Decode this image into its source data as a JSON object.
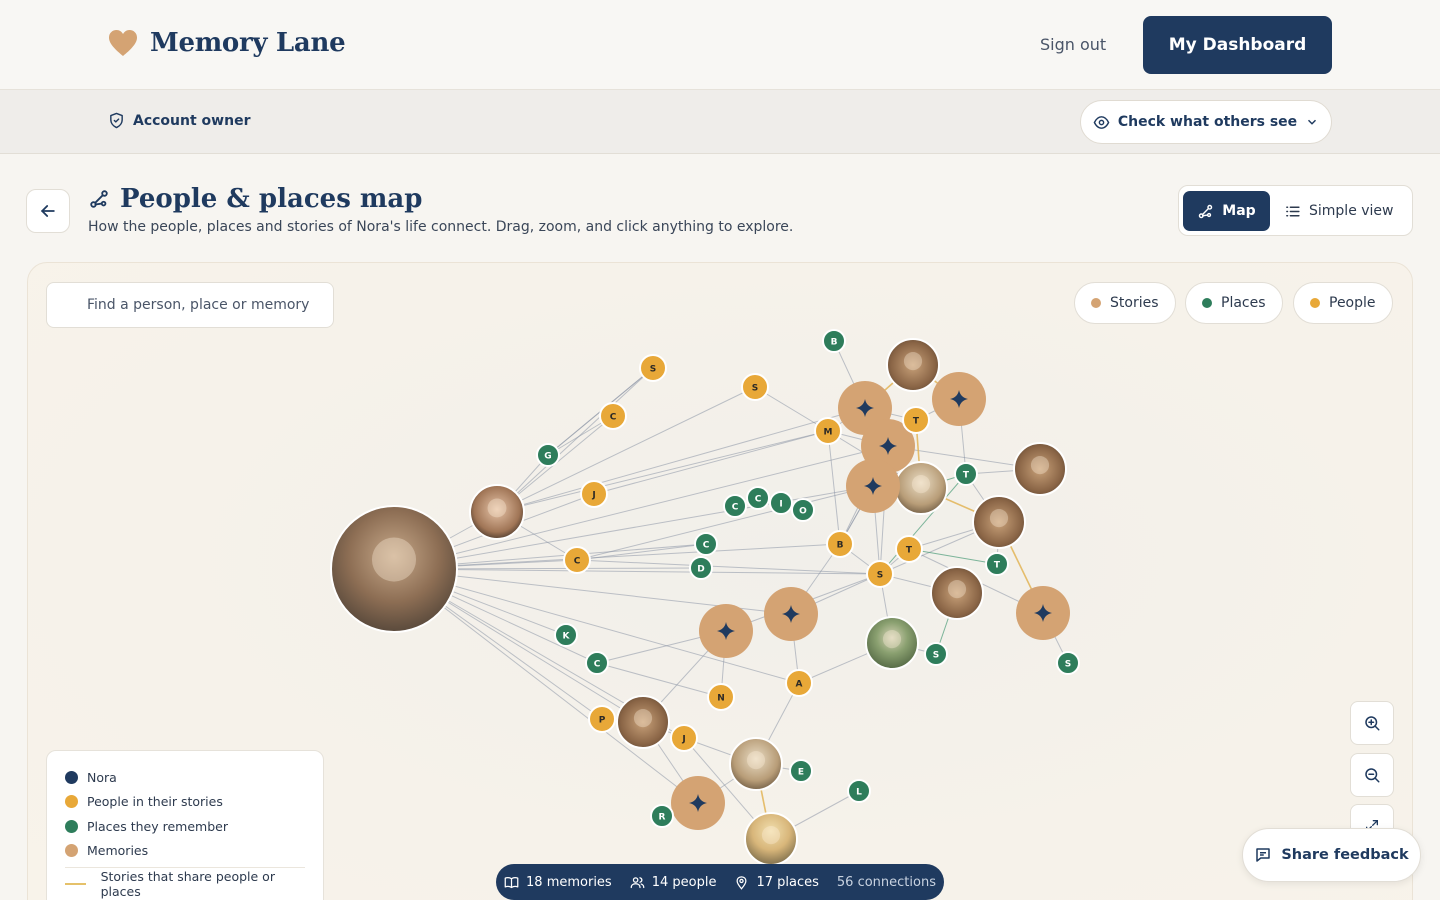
{
  "brand": {
    "name": "Memory Lane",
    "heart_color": "#d4a373"
  },
  "header": {
    "signout_label": "Sign out",
    "dashboard_label": "My Dashboard"
  },
  "subbar": {
    "owner_label": "Account owner",
    "check_label": "Check what others see"
  },
  "page": {
    "title": "People & places map",
    "subtitle": "How the people, places and stories of Nora's life connect. Drag, zoom, and click anything to explore.",
    "view_tabs": {
      "map": "Map",
      "simple": "Simple view"
    }
  },
  "search": {
    "placeholder": "Find a person, place or memory"
  },
  "filters": [
    {
      "label": "Stories",
      "color": "#d4a373"
    },
    {
      "label": "Places",
      "color": "#2e7d5b"
    },
    {
      "label": "People",
      "color": "#e8a838"
    }
  ],
  "legend": {
    "items": [
      {
        "label": "Nora",
        "color": "#1f3a5f"
      },
      {
        "label": "People in their stories",
        "color": "#e8a838"
      },
      {
        "label": "Places they remember",
        "color": "#2e7d5b"
      },
      {
        "label": "Memories",
        "color": "#d4a373"
      }
    ],
    "line_label": "Stories that share people or places",
    "line_color": "#e5c16a"
  },
  "stats": {
    "memories": "18 memories",
    "people": "14 people",
    "places": "17 places",
    "connections": "56 connections"
  },
  "feedback_label": "Share feedback",
  "graph": {
    "people_letters": [
      "S",
      "S",
      "C",
      "J",
      "M",
      "T",
      "C",
      "B",
      "T",
      "S",
      "N",
      "A",
      "P",
      "J"
    ],
    "place_letters": [
      "B",
      "G",
      "C",
      "C",
      "I",
      "O",
      "C",
      "D",
      "T",
      "T",
      "K",
      "C",
      "S",
      "S",
      "E",
      "L",
      "R"
    ]
  }
}
